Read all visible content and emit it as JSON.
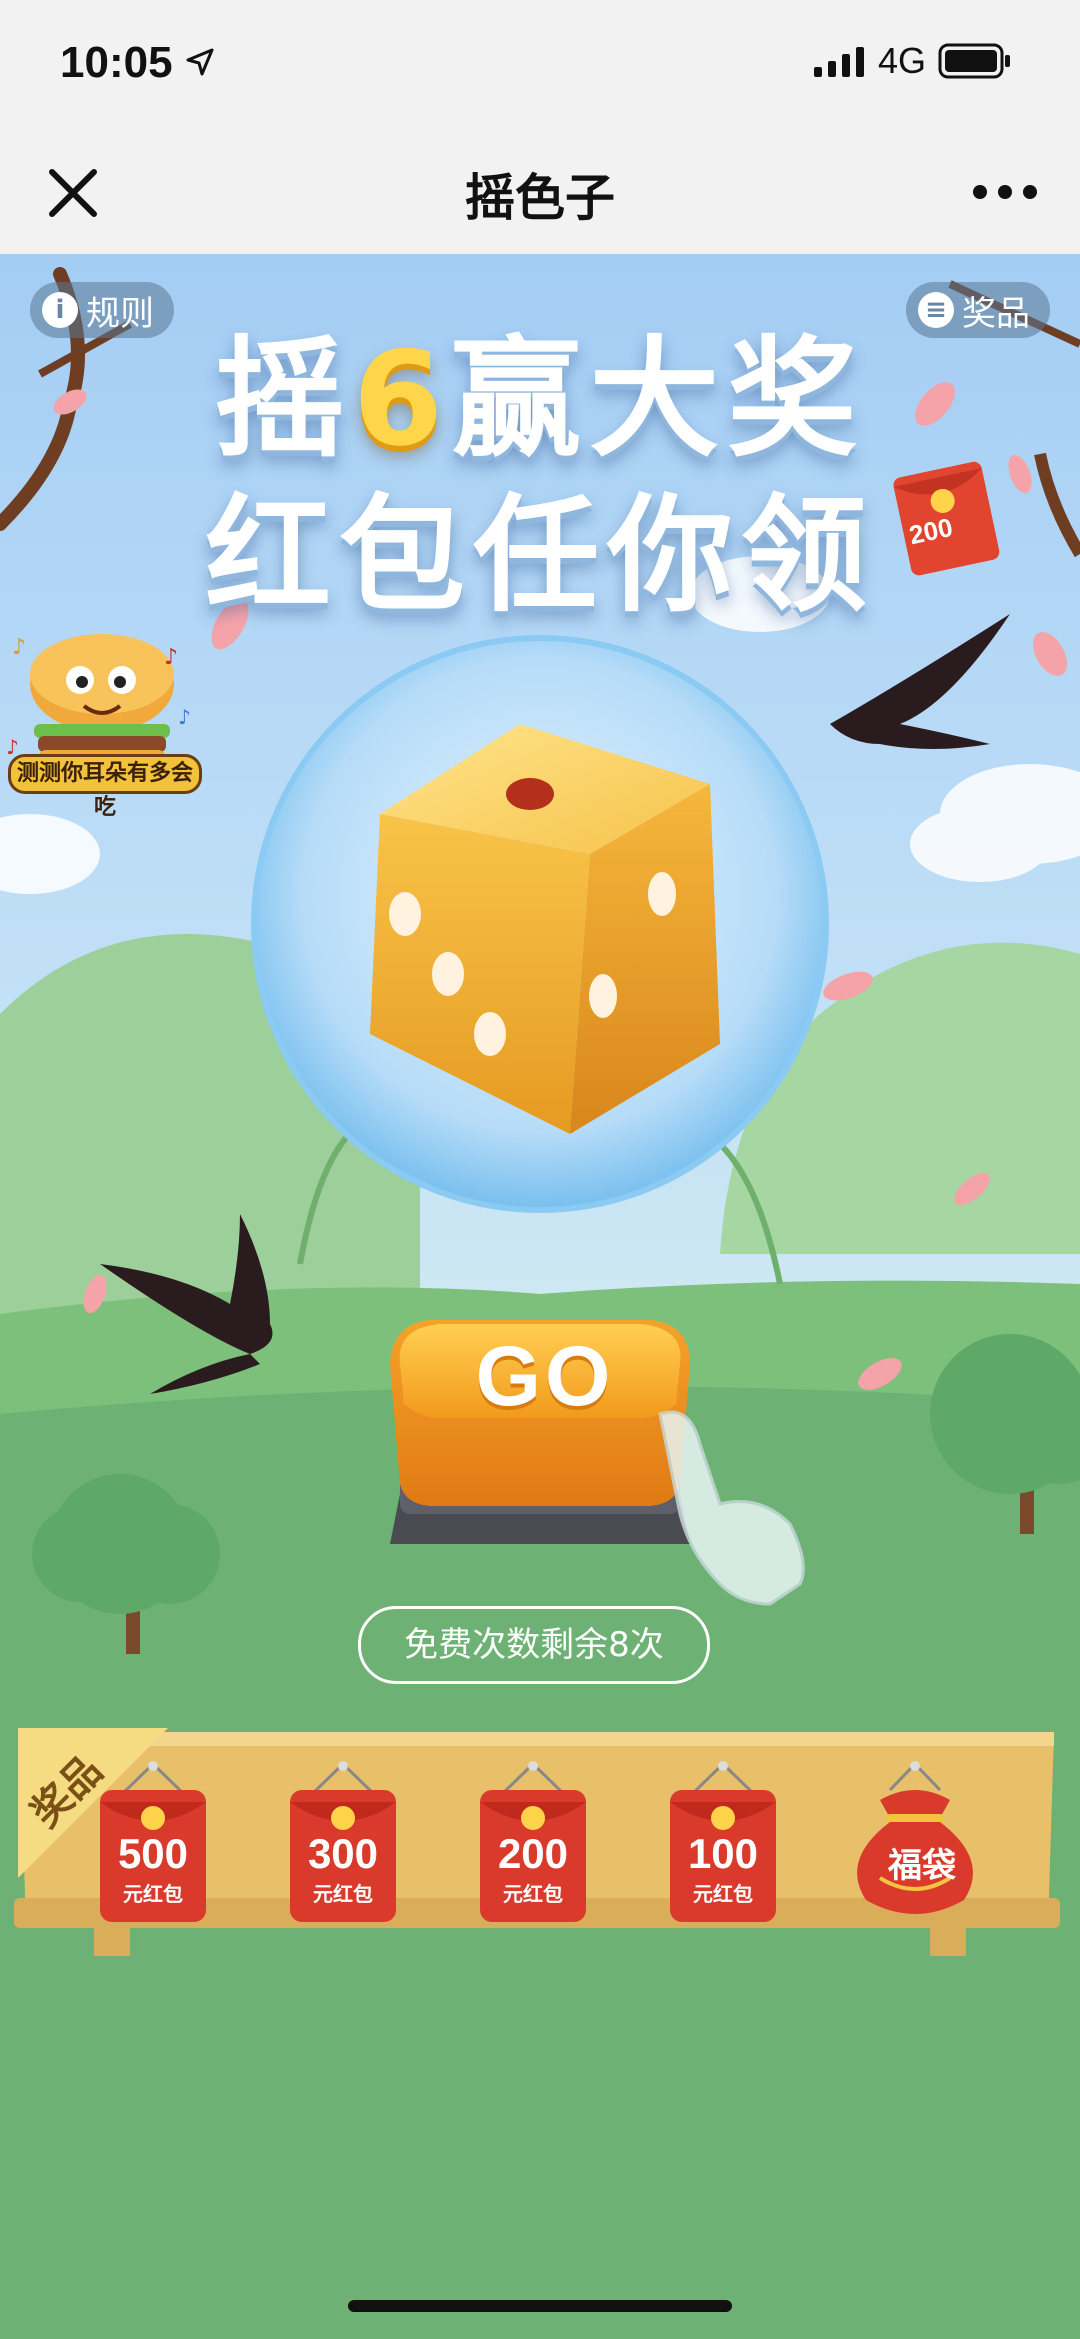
{
  "status_bar": {
    "time": "10:05",
    "network": "4G"
  },
  "nav": {
    "title": "摇色子"
  },
  "top_buttons": {
    "rules": "规则",
    "prizes": "奖品"
  },
  "headline": {
    "line1_a": "摇",
    "line1_b": "6",
    "line1_c": "赢大奖",
    "line2": "红包任你领"
  },
  "badge_200": "200",
  "promo": {
    "label": "测测你耳朵有多会吃"
  },
  "go_button": {
    "label": "GO"
  },
  "free_times": "免费次数剩余8次",
  "prize_board": {
    "corner_label": "奖品",
    "items": [
      {
        "amount": "500",
        "unit": "元红包"
      },
      {
        "amount": "300",
        "unit": "元红包"
      },
      {
        "amount": "200",
        "unit": "元红包"
      },
      {
        "amount": "100",
        "unit": "元红包"
      }
    ],
    "bag_label": "福袋"
  },
  "colors": {
    "sky_top": "#a9d0f5",
    "grass": "#6db274",
    "board": "#e8c06a",
    "red_packet": "#d93a2b",
    "gold": "#ffd64a"
  }
}
